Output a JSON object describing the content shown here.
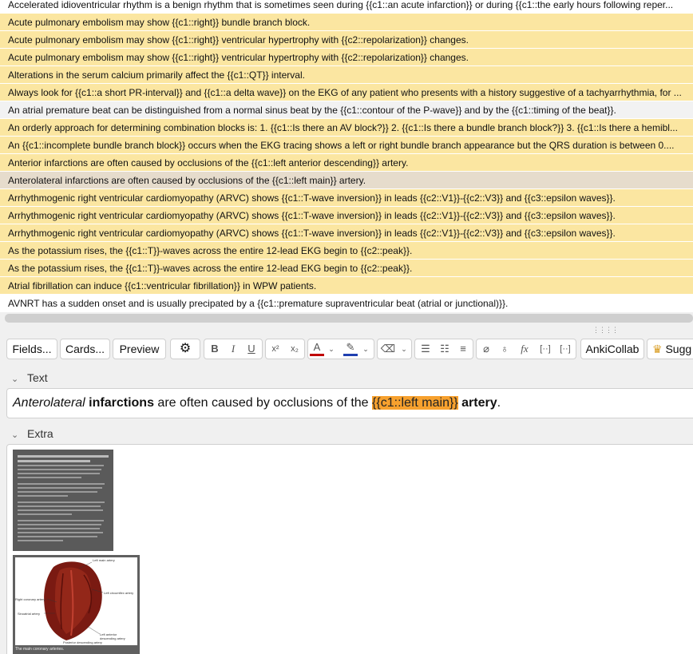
{
  "cards": [
    {
      "text": "Accelerated idioventricular rhythm is a benign rhythm that is sometimes seen during {{c1::an acute infarction}} or during {{c1::the early hours following reper...",
      "style": "w"
    },
    {
      "text": "Acute pulmonary embolism may show {{c1::right}} bundle branch block.",
      "style": "y"
    },
    {
      "text": "Acute pulmonary embolism may show {{c1::right}} ventricular hypertrophy with {{c2::repolarization}} changes.",
      "style": "y"
    },
    {
      "text": "Acute pulmonary embolism may show {{c1::right}} ventricular hypertrophy with {{c2::repolarization}} changes.",
      "style": "y"
    },
    {
      "text": "Alterations in the serum calcium primarily affect the {{c1::QT}} interval.",
      "style": "y"
    },
    {
      "text": "Always look for {{c1::a short PR-interval}} and {{c1::a delta wave}} on the EKG of any patient who presents with a history suggestive of a tachyarrhythmia, for ...",
      "style": "y"
    },
    {
      "text": "An atrial premature beat can be distinguished from a normal sinus beat by the {{c1::contour of the P-wave}} and by the {{c1::timing of the beat}}.",
      "style": "g"
    },
    {
      "text": "An orderly approach for determining combination blocks is:  1. {{c1::Is there an AV block?}} 2. {{c1::Is there a bundle branch block?}} 3. {{c1::Is there a hemibl...",
      "style": "y"
    },
    {
      "text": "An {{c1::incomplete bundle branch block}} occurs when the EKG tracing shows a left or right bundle branch appearance but the QRS duration is between 0....",
      "style": "y"
    },
    {
      "text": "Anterior infarctions are often caused by occlusions of the {{c1::left anterior descending}} artery.",
      "style": "y"
    },
    {
      "text": "Anterolateral infarctions are often caused by occlusions of the {{c1::left main}} artery.",
      "style": "s"
    },
    {
      "text": "Arrhythmogenic right ventricular cardiomyopathy (ARVC) shows {{c1::T-wave inversion}} in leads {{c2::V1}}-{{c2::V3}} and {{c3::epsilon waves}}.",
      "style": "y"
    },
    {
      "text": "Arrhythmogenic right ventricular cardiomyopathy (ARVC) shows {{c1::T-wave inversion}} in leads {{c2::V1}}-{{c2::V3}} and {{c3::epsilon waves}}.",
      "style": "y"
    },
    {
      "text": "Arrhythmogenic right ventricular cardiomyopathy (ARVC) shows {{c1::T-wave inversion}} in leads {{c2::V1}}-{{c2::V3}} and {{c3::epsilon waves}}.",
      "style": "y"
    },
    {
      "text": "As the potassium rises, the {{c1::T}}-waves across the entire 12-lead EKG begin to {{c2::peak}}.",
      "style": "y"
    },
    {
      "text": "As the potassium rises, the {{c1::T}}-waves across the entire 12-lead EKG begin to {{c2::peak}}.",
      "style": "y"
    },
    {
      "text": "Atrial fibrillation can induce {{c1::ventricular fibrillation}} in WPW patients.",
      "style": "y"
    },
    {
      "text": "AVNRT has a sudden onset and is usually precipated by a {{c1::premature supraventricular beat (atrial or junctional)}}.",
      "style": "w"
    }
  ],
  "toolbar": {
    "fields": "Fields...",
    "cards": "Cards...",
    "preview": "Preview",
    "ankicollab": "AnkiCollab",
    "suggest": "Sugg"
  },
  "editor": {
    "text_label": "Text",
    "extra_label": "Extra",
    "text_italic": "Anterolateral",
    "text_bold": "infarctions",
    "text_mid": " are often caused by occlusions of the ",
    "text_cloze": "{{c1::left main}}",
    "text_bold2": "artery",
    "text_end": "."
  },
  "figure": {
    "caption": "The main coronary arteries.",
    "labels": {
      "left_main": "Left main artery",
      "left_circumflex": "Left circumflex artery",
      "right_coronary": "Right coronary artery",
      "sinoatrial": "Sinoatrial artery",
      "lad": "Left anterior descending artery",
      "posterior": "Posterior descending artery"
    }
  },
  "icons": {
    "gear": "gear-icon",
    "bold": "bold-icon",
    "italic": "italic-icon",
    "underline": "underline-icon",
    "superscript": "superscript-icon",
    "subscript": "subscript-icon",
    "text_color": "text-color-icon",
    "highlight": "highlight-icon",
    "eraser": "eraser-icon",
    "list_bullet": "bullet-list-icon",
    "list_number": "numbered-list-icon",
    "align": "align-icon",
    "attach": "paperclip-icon",
    "mic": "microphone-icon",
    "formula": "formula-icon",
    "cloze": "cloze-icon",
    "cloze_same": "cloze-same-icon",
    "crown": "crown-icon"
  },
  "colors": {
    "highlight_row": "#fbe6a1",
    "selected_row": "#e6dccc",
    "cloze_bg": "#f7a12e",
    "text_color_bar": "#c00000",
    "highlight_bar": "#1f3fb0"
  }
}
